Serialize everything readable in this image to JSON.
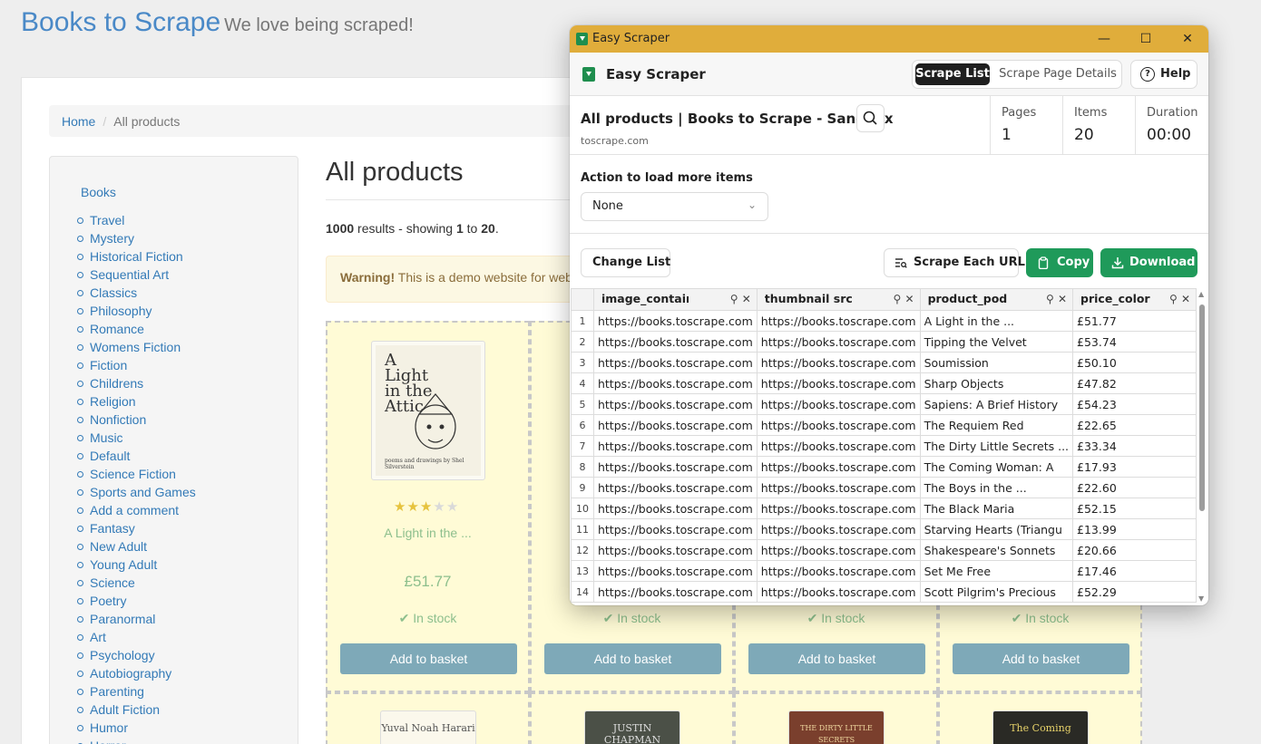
{
  "site": {
    "brand": "Books to Scrape",
    "tagline": "We love being scraped!",
    "breadcrumb": {
      "home": "Home",
      "current": "All products"
    },
    "sidebar_heading": "Books",
    "categories": [
      "Travel",
      "Mystery",
      "Historical Fiction",
      "Sequential Art",
      "Classics",
      "Philosophy",
      "Romance",
      "Womens Fiction",
      "Fiction",
      "Childrens",
      "Religion",
      "Nonfiction",
      "Music",
      "Default",
      "Science Fiction",
      "Sports and Games",
      "Add a comment",
      "Fantasy",
      "New Adult",
      "Young Adult",
      "Science",
      "Poetry",
      "Paranormal",
      "Art",
      "Psychology",
      "Autobiography",
      "Parenting",
      "Adult Fiction",
      "Humor",
      "Horror"
    ],
    "page_title": "All products",
    "results": {
      "count": "1000",
      "pre": " results - showing ",
      "from": "1",
      "to_word": " to ",
      "to": "20",
      "end": "."
    },
    "warning": {
      "strong": "Warning!",
      "text": " This is a demo website for web"
    },
    "first_book": {
      "cover_title": "A Light in the Attic",
      "cover_author": "poems and drawings by Shel Silverstein",
      "title": "A Light in the ...",
      "price": "£51.77",
      "rating": 3
    },
    "stock_label": "In stock",
    "basket_label": "Add to basket",
    "row2_covers": [
      "Yuval Noah Harari",
      "JUSTIN CHAPMAN",
      "THE DIRTY LITTLE SECRETS",
      "The Coming"
    ]
  },
  "scraper": {
    "window_title": "Easy Scraper",
    "app_name": "Easy Scraper",
    "tabs": {
      "active": "Scrape List",
      "inactive": "Scrape Page Details"
    },
    "help": "Help",
    "page_title": "All products | Books to Scrape - Sandbox",
    "host": "toscrape.com",
    "stats": [
      {
        "label": "Pages",
        "value": "1"
      },
      {
        "label": "Items",
        "value": "20"
      },
      {
        "label": "Duration",
        "value": "00:00"
      }
    ],
    "action_label": "Action to load more items",
    "action_value": "None",
    "buttons": {
      "change": "Change List",
      "each": "Scrape Each URL",
      "copy": "Copy",
      "download": "Download"
    },
    "columns": [
      "image_contain",
      "thumbnail src",
      "product_pod",
      "price_color"
    ],
    "rows": [
      [
        "1",
        "https://books.toscrape.com",
        "https://books.toscrape.com",
        "A Light in the ...",
        "£51.77"
      ],
      [
        "2",
        "https://books.toscrape.com",
        "https://books.toscrape.com",
        "Tipping the Velvet",
        "£53.74"
      ],
      [
        "3",
        "https://books.toscrape.com",
        "https://books.toscrape.com",
        "Soumission",
        "£50.10"
      ],
      [
        "4",
        "https://books.toscrape.com",
        "https://books.toscrape.com",
        "Sharp Objects",
        "£47.82"
      ],
      [
        "5",
        "https://books.toscrape.com",
        "https://books.toscrape.com",
        "Sapiens: A Brief History",
        "£54.23"
      ],
      [
        "6",
        "https://books.toscrape.com",
        "https://books.toscrape.com",
        "The Requiem Red",
        "£22.65"
      ],
      [
        "7",
        "https://books.toscrape.com",
        "https://books.toscrape.com",
        "The Dirty Little Secrets ...",
        "£33.34"
      ],
      [
        "8",
        "https://books.toscrape.com",
        "https://books.toscrape.com",
        "The Coming Woman: A",
        "£17.93"
      ],
      [
        "9",
        "https://books.toscrape.com",
        "https://books.toscrape.com",
        "The Boys in the ...",
        "£22.60"
      ],
      [
        "10",
        "https://books.toscrape.com",
        "https://books.toscrape.com",
        "The Black Maria",
        "£52.15"
      ],
      [
        "11",
        "https://books.toscrape.com",
        "https://books.toscrape.com",
        "Starving Hearts (Triangu",
        "£13.99"
      ],
      [
        "12",
        "https://books.toscrape.com",
        "https://books.toscrape.com",
        "Shakespeare's Sonnets",
        "£20.66"
      ],
      [
        "13",
        "https://books.toscrape.com",
        "https://books.toscrape.com",
        "Set Me Free",
        "£17.46"
      ],
      [
        "14",
        "https://books.toscrape.com",
        "https://books.toscrape.com",
        "Scott Pilgrim's Precious",
        "£52.29"
      ]
    ]
  }
}
